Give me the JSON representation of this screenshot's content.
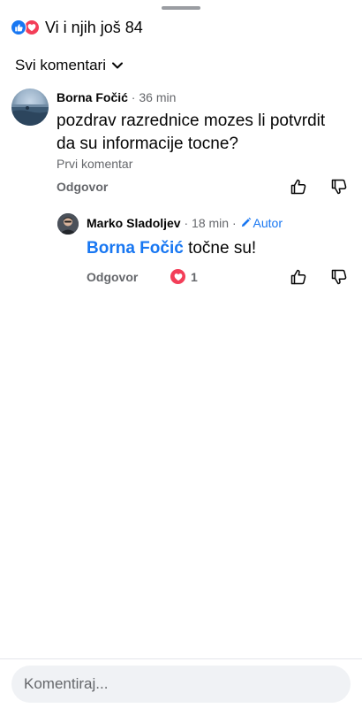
{
  "reactions": {
    "summary_text": "Vi i njih još 84",
    "icons": [
      "like-icon",
      "love-icon"
    ]
  },
  "sort": {
    "label": "Svi komentari",
    "icon": "chevron-down-icon"
  },
  "comments": [
    {
      "author": "Borna Fočić",
      "separator": " · ",
      "time": "36 min",
      "text": "pozdrav razrednice mozes li potvrdit da su informacije tocne?",
      "sub_label": "Prvi komentar",
      "reply_label": "Odgovor",
      "reply": {
        "author": "Marko Sladoljev",
        "separator": " · ",
        "time": "18 min",
        "separator2": " · ",
        "badge": "Autor",
        "mention": "Borna Fočić",
        "text": " točne su!",
        "reply_label": "Odgovor",
        "love_count": "1"
      }
    }
  ],
  "composer": {
    "placeholder": "Komentiraj..."
  },
  "colors": {
    "accent": "#1877f2",
    "love": "#f33e58",
    "muted": "#65676b"
  }
}
